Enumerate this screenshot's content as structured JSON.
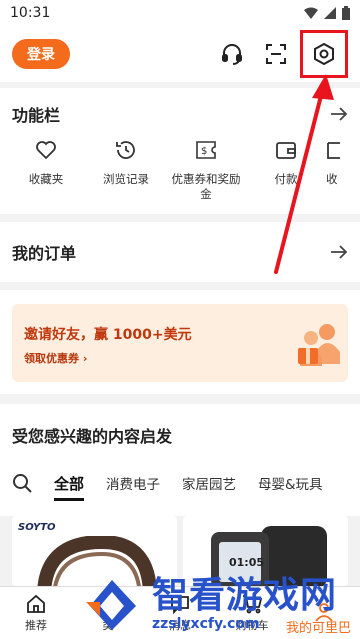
{
  "status": {
    "time": "10:31"
  },
  "header": {
    "login_label": "登录"
  },
  "features": {
    "title": "功能栏",
    "items": [
      {
        "label": "收藏夹",
        "icon": "heart-icon"
      },
      {
        "label": "浏览记录",
        "icon": "history-icon"
      },
      {
        "label": "优惠券和奖励金",
        "icon": "coupon-icon"
      },
      {
        "label": "付款",
        "icon": "wallet-icon"
      },
      {
        "label": "收",
        "icon": "inbox-icon"
      }
    ]
  },
  "orders": {
    "title": "我的订单"
  },
  "invite": {
    "title": "邀请好友，赢 1000+美元",
    "sub": "领取优惠券 ›"
  },
  "recommend": {
    "title": "受您感兴趣的内容启发",
    "tabs": [
      "全部",
      "消费电子",
      "家居园艺",
      "母婴&玩具"
    ],
    "active_tab": "全部"
  },
  "products": [
    {
      "brand": "SOYTO"
    },
    {
      "screen_time": "01:05"
    }
  ],
  "bottom_nav": [
    {
      "label": "推荐"
    },
    {
      "label": "类"
    },
    {
      "label": "消息"
    },
    {
      "label": "购物车"
    },
    {
      "label": ""
    }
  ],
  "watermark": {
    "text": "智看游戏网",
    "url": "zzslyxcfy.com",
    "tag": "我的可里巴"
  },
  "colors": {
    "accent": "#f36b1b",
    "highlight": "#e8141e",
    "watermark": "#2752c9"
  }
}
